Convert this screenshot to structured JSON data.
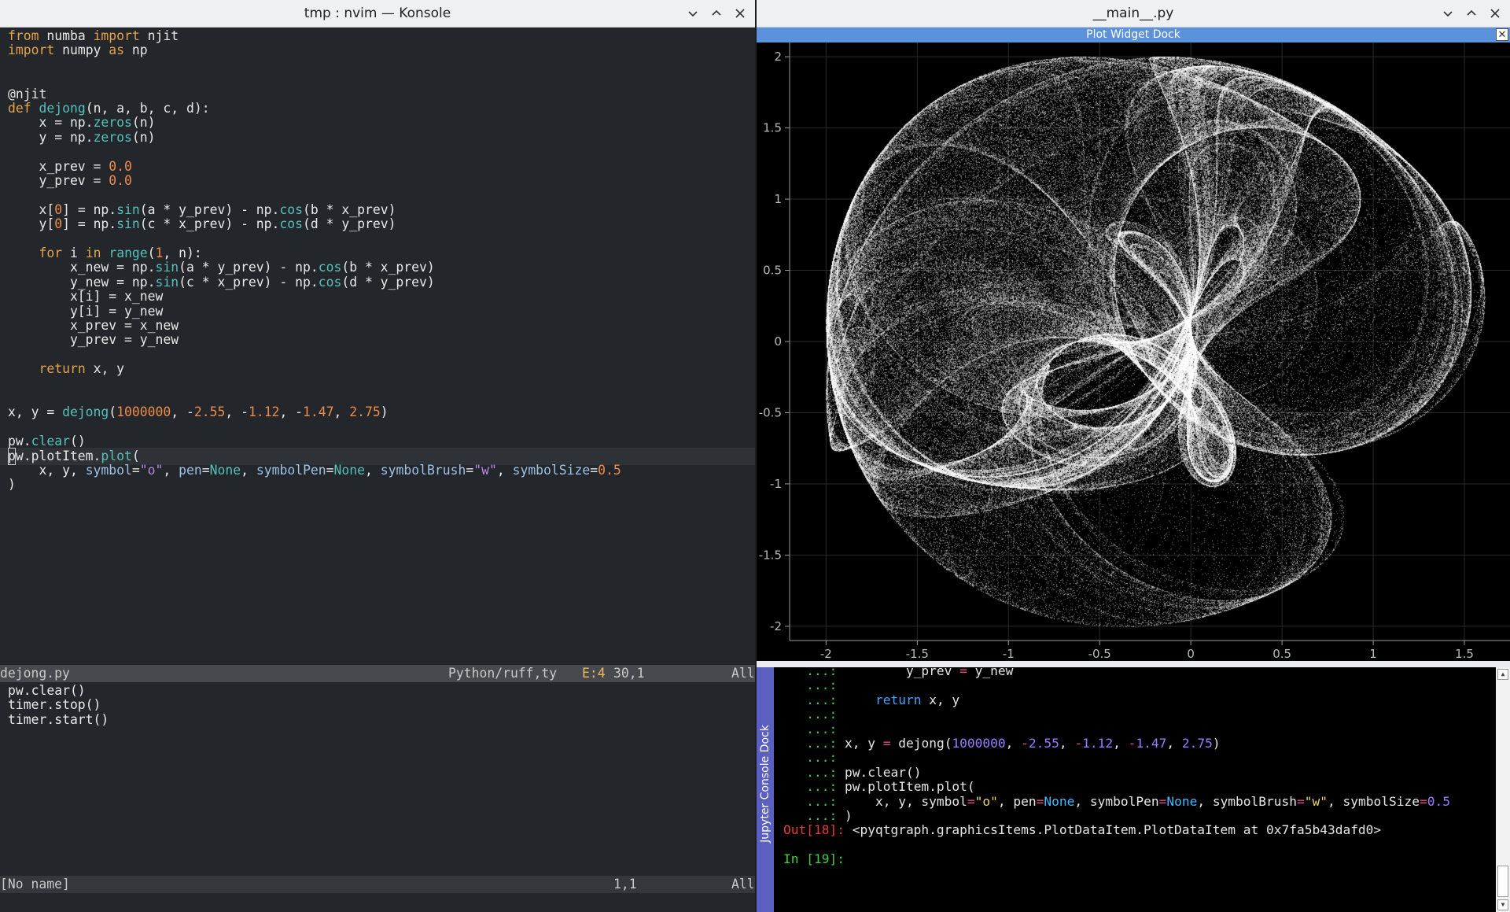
{
  "konsole": {
    "title": "tmp : nvim — Konsole",
    "code": [
      "from numba import njit",
      "import numpy as np",
      "",
      "",
      "@njit",
      "def dejong(n, a, b, c, d):",
      "    x = np.zeros(n)",
      "    y = np.zeros(n)",
      "",
      "    x_prev = 0.0",
      "    y_prev = 0.0",
      "",
      "    x[0] = np.sin(a * y_prev) - np.cos(b * x_prev)",
      "    y[0] = np.sin(c * x_prev) - np.cos(d * y_prev)",
      "",
      "    for i in range(1, n):",
      "        x_new = np.sin(a * y_prev) - np.cos(b * x_prev)",
      "        y_new = np.sin(c * x_prev) - np.cos(d * y_prev)",
      "        x[i] = x_new",
      "        y[i] = y_new",
      "        x_prev = x_new",
      "        y_prev = y_new",
      "",
      "    return x, y",
      "",
      "",
      "x, y = dejong(1000000, -2.55, -1.12, -1.47, 2.75)",
      "",
      "pw.clear()",
      "pw.plotItem.plot(",
      "    x, y, symbol=\"o\", pen=None, symbolPen=None, symbolBrush=\"w\", symbolSize=0.5",
      ")"
    ],
    "statusline": {
      "filename": "dejong.py",
      "filetype": "Python/ruff,ty",
      "errors": "E:4",
      "position": "30,1",
      "scroll": "All"
    },
    "bottom_buffer": [
      "pw.clear()",
      "timer.stop()",
      "timer.start()"
    ],
    "statusline2": {
      "filename": "[No name]",
      "position": "1,1",
      "scroll": "All"
    }
  },
  "pywindow": {
    "title": "__main__.py",
    "plot_dock_title": "Plot Widget Dock",
    "console_dock_title": "Jupyter Console Dock",
    "console": {
      "lines": [
        {
          "prompt": "   ...:",
          "code": "        y_prev = y_new"
        },
        {
          "prompt": "   ...:",
          "code": ""
        },
        {
          "prompt": "   ...:",
          "code": "    return x, y"
        },
        {
          "prompt": "   ...:",
          "code": ""
        },
        {
          "prompt": "   ...:",
          "code": ""
        },
        {
          "prompt": "   ...:",
          "code": "x, y = dejong(1000000, -2.55, -1.12, -1.47, 2.75)"
        },
        {
          "prompt": "   ...:",
          "code": ""
        },
        {
          "prompt": "   ...:",
          "code": "pw.clear()"
        },
        {
          "prompt": "   ...:",
          "code": "pw.plotItem.plot("
        },
        {
          "prompt": "   ...:",
          "code": "    x, y, symbol=\"o\", pen=None, symbolPen=None, symbolBrush=\"w\", symbolSize=0.5"
        },
        {
          "prompt": "   ...:",
          "code": ")"
        }
      ],
      "out_prompt": "Out[18]:",
      "out_text": "<pyqtgraph.graphicsItems.PlotDataItem.PlotDataItem at 0x7fa5b43dafd0>",
      "in_prompt": "In [19]:"
    }
  },
  "chart_data": {
    "type": "scatter",
    "title": "",
    "xlabel": "",
    "ylabel": "",
    "x_ticks": [
      "-2",
      "-1.5",
      "-1",
      "-0.5",
      "0",
      "0.5",
      "1",
      "1.5"
    ],
    "y_ticks": [
      "2",
      "1.5",
      "1",
      "0.5",
      "0",
      "-0.5",
      "-1",
      "-1.5",
      "-2"
    ],
    "xlim": [
      -2.2,
      1.75
    ],
    "ylim": [
      -2.1,
      2.1
    ],
    "grid": true,
    "legend": "none",
    "background": "#000000",
    "marker_color": "#ffffff",
    "series": [
      {
        "generator": "de Jong attractor",
        "n": 1000000,
        "a": -2.55,
        "b": -1.12,
        "c": -1.47,
        "d": 2.75
      }
    ]
  }
}
